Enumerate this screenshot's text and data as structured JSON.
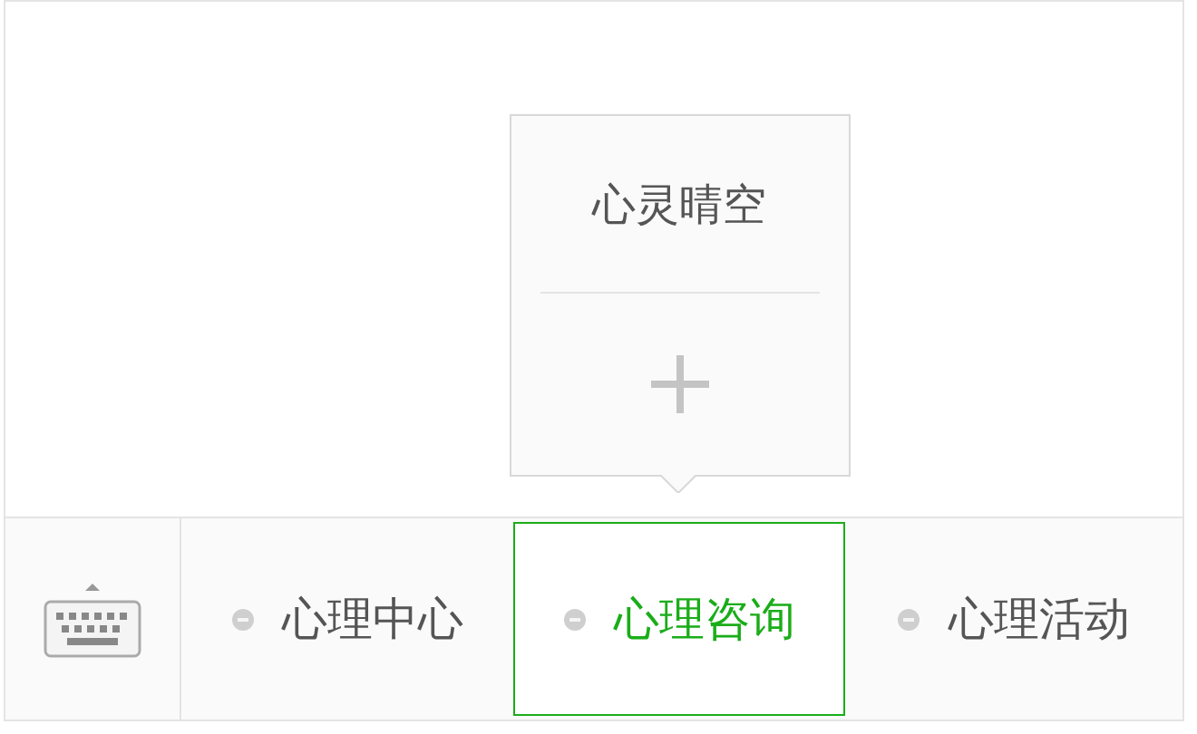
{
  "menu": [
    {
      "label": "心理中心",
      "selected": false
    },
    {
      "label": "心理咨询",
      "selected": true,
      "sub_items": [
        {
          "label": "心灵晴空"
        }
      ]
    },
    {
      "label": "心理活动",
      "selected": false
    }
  ]
}
